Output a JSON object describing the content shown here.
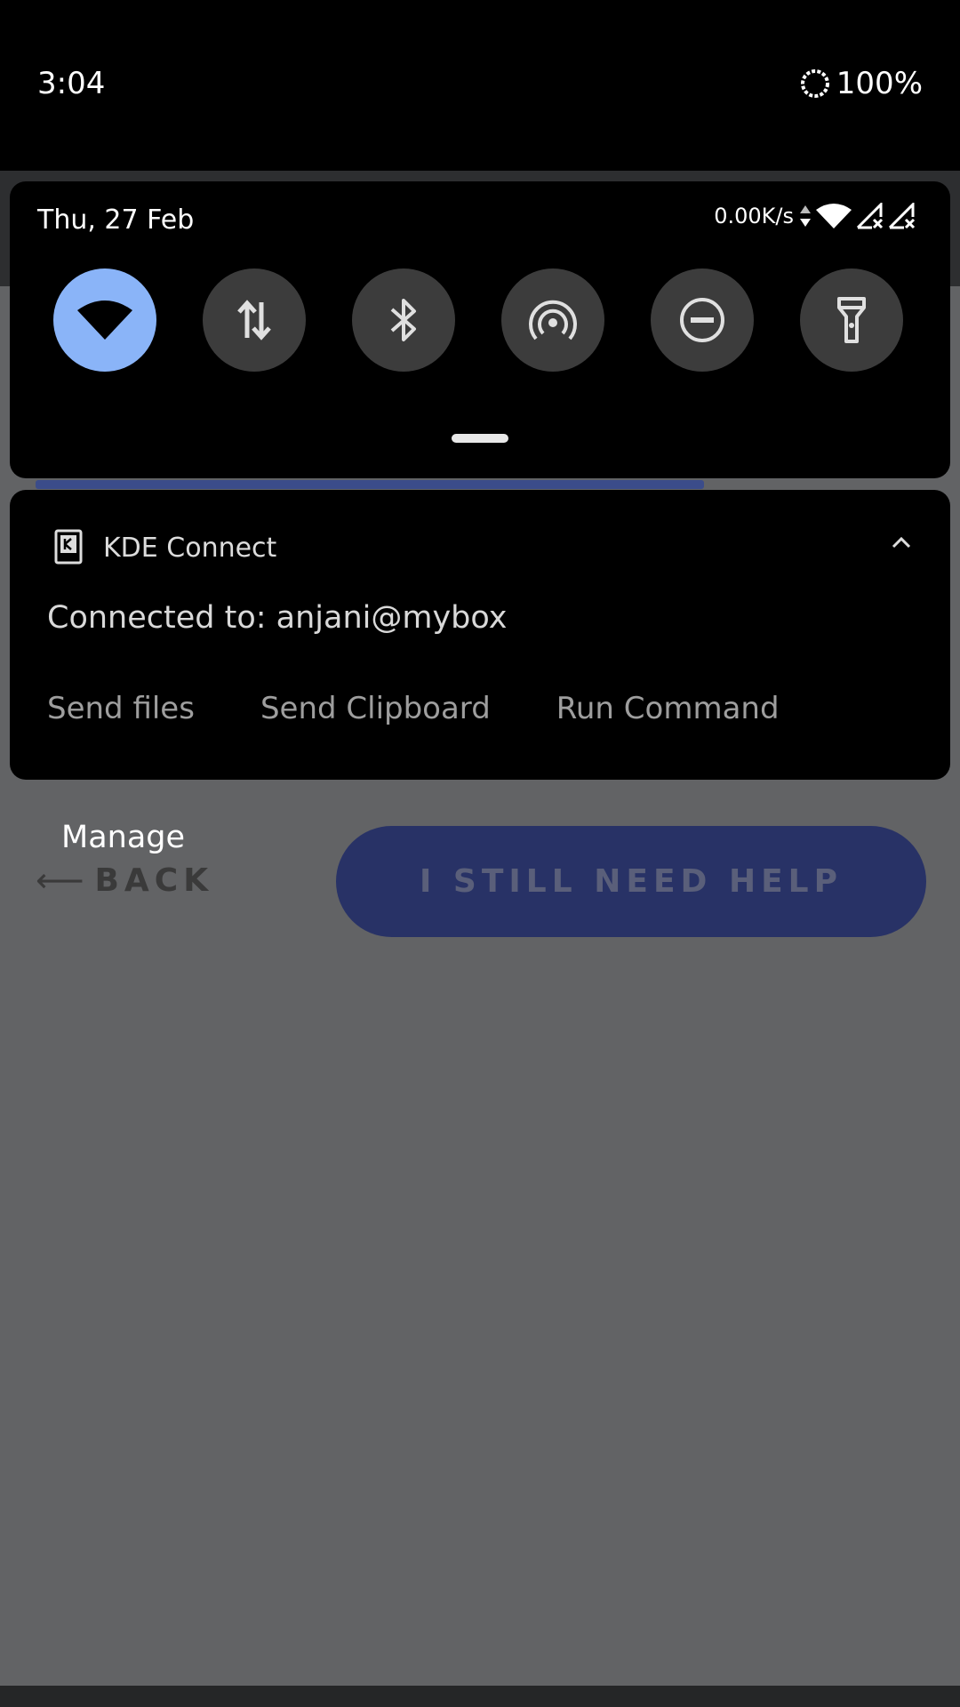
{
  "status_bar": {
    "time": "3:04",
    "battery": "100%",
    "battery_icon": "battery-saver-ring-icon"
  },
  "quick_settings": {
    "date": "Thu, 27 Feb",
    "net_speed": "0.00K/s",
    "status_icons": [
      "data-arrows-icon",
      "wifi-icon",
      "signal-no-sim-icon",
      "signal-no-sim-icon"
    ],
    "tiles": [
      {
        "name": "wifi",
        "icon": "wifi-icon",
        "active": true
      },
      {
        "name": "mobile-data",
        "icon": "data-arrows-icon",
        "active": false
      },
      {
        "name": "bluetooth",
        "icon": "bluetooth-icon",
        "active": false
      },
      {
        "name": "hotspot",
        "icon": "hotspot-icon",
        "active": false
      },
      {
        "name": "do-not-disturb",
        "icon": "do-not-disturb-icon",
        "active": false
      },
      {
        "name": "flashlight",
        "icon": "flashlight-icon",
        "active": false
      }
    ],
    "colors": {
      "active_tile": "#8ab4f8",
      "inactive_tile": "#3c3c3c"
    }
  },
  "notification": {
    "app_name": "KDE Connect",
    "text": "Connected to: anjani@mybox",
    "actions": [
      "Send files",
      "Send Clipboard",
      "Run Command"
    ]
  },
  "page": {
    "manage_label": "Manage",
    "back_arrow": "⟵",
    "back_label": "BACK",
    "help_button_label": "I STILL NEED HELP",
    "colors": {
      "help_button": "#283266",
      "background": "#626365"
    }
  }
}
